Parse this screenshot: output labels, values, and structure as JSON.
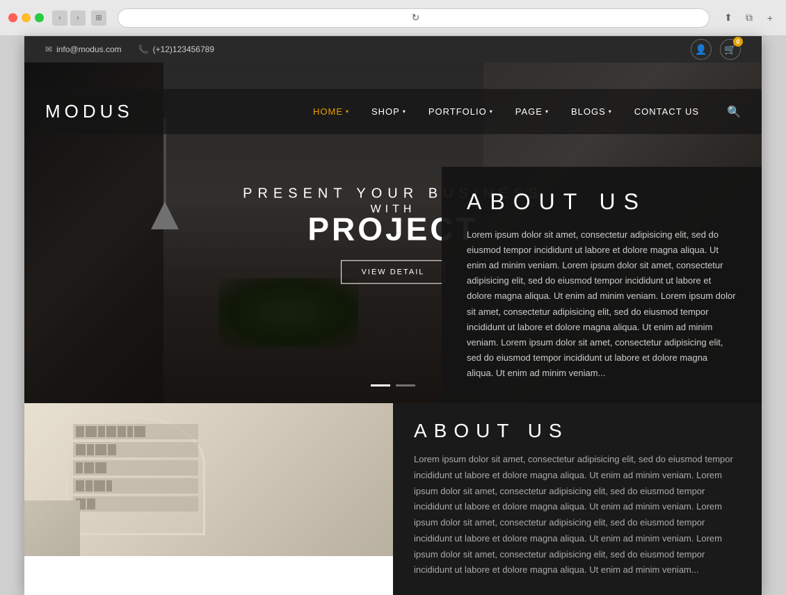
{
  "browser": {
    "address": ""
  },
  "topbar": {
    "email": "info@modus.com",
    "phone": "(+12)123456789",
    "cart_count": "0"
  },
  "logo": "MODUS",
  "nav": {
    "items": [
      {
        "label": "HOME",
        "active": true,
        "has_arrow": true
      },
      {
        "label": "SHOP",
        "active": false,
        "has_arrow": true
      },
      {
        "label": "PORTFOLIO",
        "active": false,
        "has_arrow": true
      },
      {
        "label": "PAGE",
        "active": false,
        "has_arrow": true
      },
      {
        "label": "BLOGS",
        "active": false,
        "has_arrow": true
      },
      {
        "label": "CONTACT US",
        "active": false,
        "has_arrow": false
      }
    ]
  },
  "hero": {
    "subtitle": "PRESENT YOUR BUSINESS",
    "title_with": "WITH",
    "title_main": "PROJECT",
    "cta_label": "VIEW DETAIL"
  },
  "about": {
    "title": "ABOUT US",
    "text": "Lorem ipsum dolor sit amet, consectetur adipisicing elit, sed do eiusmod tempor incididunt ut labore et dolore magna aliqua. Ut enim ad minim veniam. Lorem ipsum dolor sit amet, consectetur adipisicing elit, sed do eiusmod tempor incididunt ut labore et dolore magna aliqua. Ut enim ad minim veniam. Lorem ipsum dolor sit amet, consectetur adipisicing elit, sed do eiusmod tempor incididunt ut labore et dolore magna aliqua. Ut enim ad minim veniam. Lorem ipsum dolor sit amet, consectetur adipisicing elit, sed do eiusmod tempor incididunt ut labore et dolore magna aliqua. Ut enim ad minim veniam..."
  },
  "colors": {
    "accent": "#e5a000",
    "nav_bg": "rgba(20,20,20,0.7)",
    "about_bg": "rgba(20,20,20,0.95)"
  }
}
